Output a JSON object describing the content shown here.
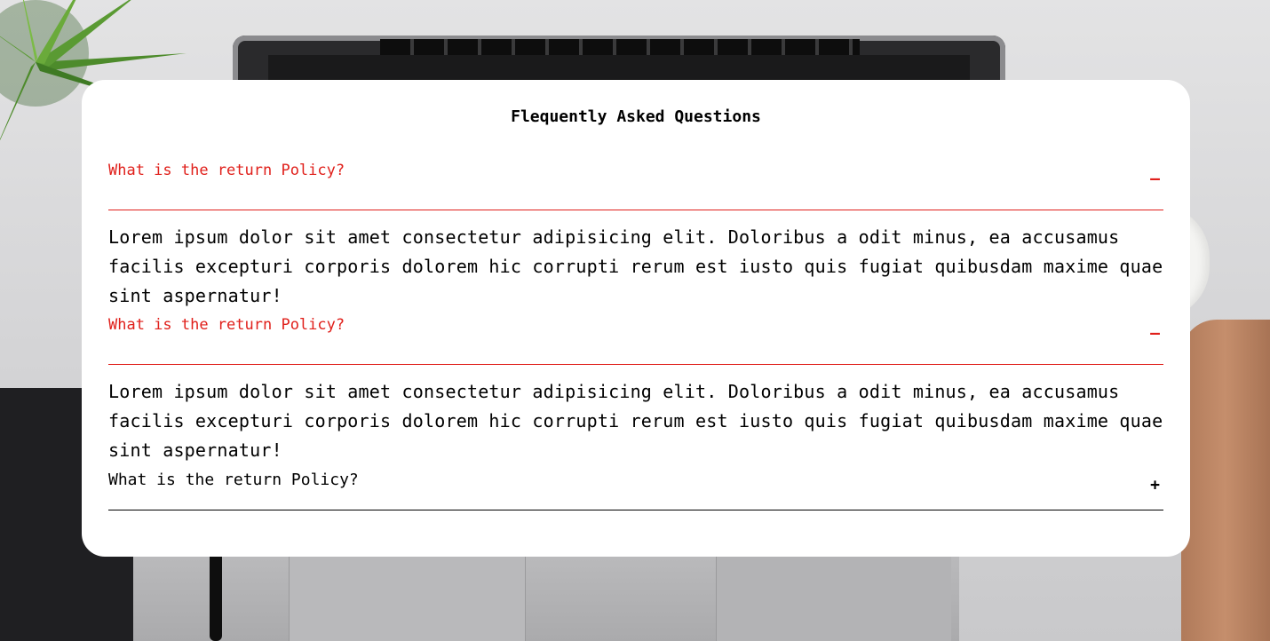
{
  "background": {
    "colors": {
      "desk": "#d9d9da",
      "accent": "#e0201b"
    }
  },
  "faq": {
    "title": "Flequently Asked Questions",
    "items": [
      {
        "question": "What is the return Policy?",
        "icon": "minus-icon",
        "toggle": "–",
        "expanded": true,
        "answer": "Lorem ipsum dolor sit amet consectetur adipisicing elit. Doloribus a odit minus, ea accusamus facilis excepturi corporis dolorem hic corrupti rerum est iusto quis fugiat quibusdam maxime quae sint aspernatur!"
      },
      {
        "question": "What is the return Policy?",
        "icon": "minus-icon",
        "toggle": "–",
        "expanded": true,
        "answer": "Lorem ipsum dolor sit amet consectetur adipisicing elit. Doloribus a odit minus, ea accusamus facilis excepturi corporis dolorem hic corrupti rerum est iusto quis fugiat quibusdam maxime quae sint aspernatur!"
      },
      {
        "question": "What is the return Policy?",
        "icon": "plus-icon",
        "toggle": "+",
        "expanded": false,
        "answer": ""
      }
    ]
  }
}
